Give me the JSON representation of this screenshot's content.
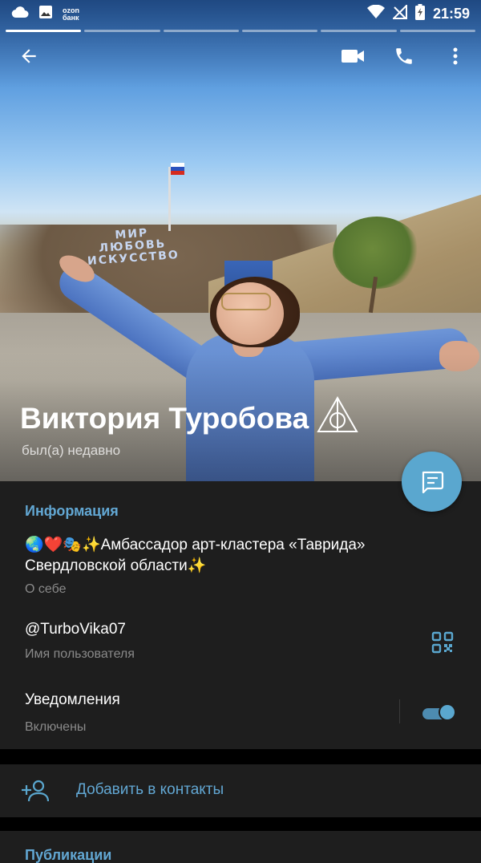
{
  "status_bar": {
    "time": "21:59",
    "ozon_line1": "ozon",
    "ozon_line2": "банк",
    "left_icons": [
      "cloud-icon",
      "image-icon"
    ],
    "right_icons": [
      "wifi-icon",
      "no-signal-icon",
      "battery-charging-icon"
    ]
  },
  "stories": {
    "count": 6,
    "active_index": 0
  },
  "toolbar": {
    "icons": [
      "back-arrow-icon",
      "video-call-icon",
      "phone-icon",
      "more-vert-icon"
    ]
  },
  "profile": {
    "name": "Виктория Туробова",
    "status": "был(а) недавно",
    "badge_icon": "deathly-hallows-icon",
    "photo_sign_lines": [
      "МИР",
      "ЛЮБОВЬ",
      "ИСКУССТВО"
    ]
  },
  "info": {
    "section_title": "Информация",
    "about_text": "🌏❤️🎭✨Амбассадор арт-кластера «Таврида» Свердловской области✨",
    "about_label": "О себе",
    "username": "@TurboVika07",
    "username_label": "Имя пользователя",
    "notifications": "Уведомления",
    "notifications_state": "Включены",
    "notifications_on": true
  },
  "add_contact": {
    "label": "Добавить в контакты"
  },
  "publications": {
    "title": "Публикации"
  },
  "colors": {
    "accent": "#62a7d3",
    "fab": "#5aa7cf",
    "panel_bg": "#1e1e1e",
    "page_bg": "#000000"
  }
}
